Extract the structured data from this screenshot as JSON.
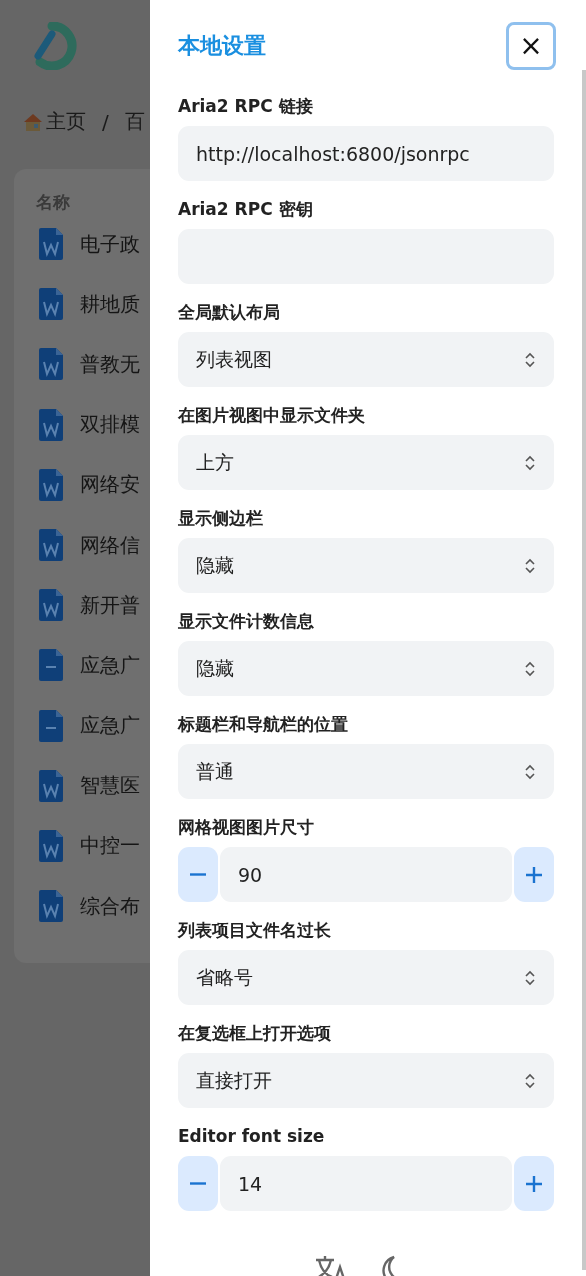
{
  "background": {
    "breadcrumb": [
      {
        "label": "主页",
        "kind": "home"
      },
      {
        "label": "/",
        "kind": "sep"
      },
      {
        "label": "百",
        "kind": "crumb"
      }
    ],
    "list_header": "名称",
    "files": [
      {
        "name": "电子政",
        "kind": "word"
      },
      {
        "name": "耕地质",
        "kind": "word"
      },
      {
        "name": "普教无",
        "kind": "word"
      },
      {
        "name": "双排模",
        "kind": "word"
      },
      {
        "name": "网络安",
        "kind": "word"
      },
      {
        "name": "网络信",
        "kind": "word"
      },
      {
        "name": "新开普",
        "kind": "word"
      },
      {
        "name": "应急广",
        "kind": "doc"
      },
      {
        "name": "应急广",
        "kind": "doc"
      },
      {
        "name": "智慧医",
        "kind": "word"
      },
      {
        "name": "中控一",
        "kind": "word"
      },
      {
        "name": "综合布",
        "kind": "word"
      }
    ]
  },
  "drawer": {
    "title": "本地设置",
    "close": "×",
    "settings": [
      {
        "label": "Aria2 RPC 链接",
        "kind": "text",
        "value": "http://localhost:6800/jsonrpc"
      },
      {
        "label": "Aria2 RPC 密钥",
        "kind": "text"
      },
      {
        "label": "全局默认布局",
        "kind": "select",
        "value": "列表视图"
      },
      {
        "label": "在图片视图中显示文件夹",
        "kind": "select",
        "value": "上方"
      },
      {
        "label": "显示侧边栏",
        "kind": "select",
        "value": "隐藏"
      },
      {
        "label": "显示文件计数信息",
        "kind": "select",
        "value": "隐藏"
      },
      {
        "label": "标题栏和导航栏的位置",
        "kind": "select",
        "value": "普通"
      },
      {
        "label": "网格视图图片尺寸",
        "kind": "number",
        "value": "90"
      },
      {
        "label": "列表项目文件名过长",
        "kind": "select",
        "value": "省略号"
      },
      {
        "label": "在复选框上打开选项",
        "kind": "select",
        "value": "直接打开"
      },
      {
        "label": "Editor font size",
        "kind": "number",
        "value": "14"
      }
    ]
  }
}
